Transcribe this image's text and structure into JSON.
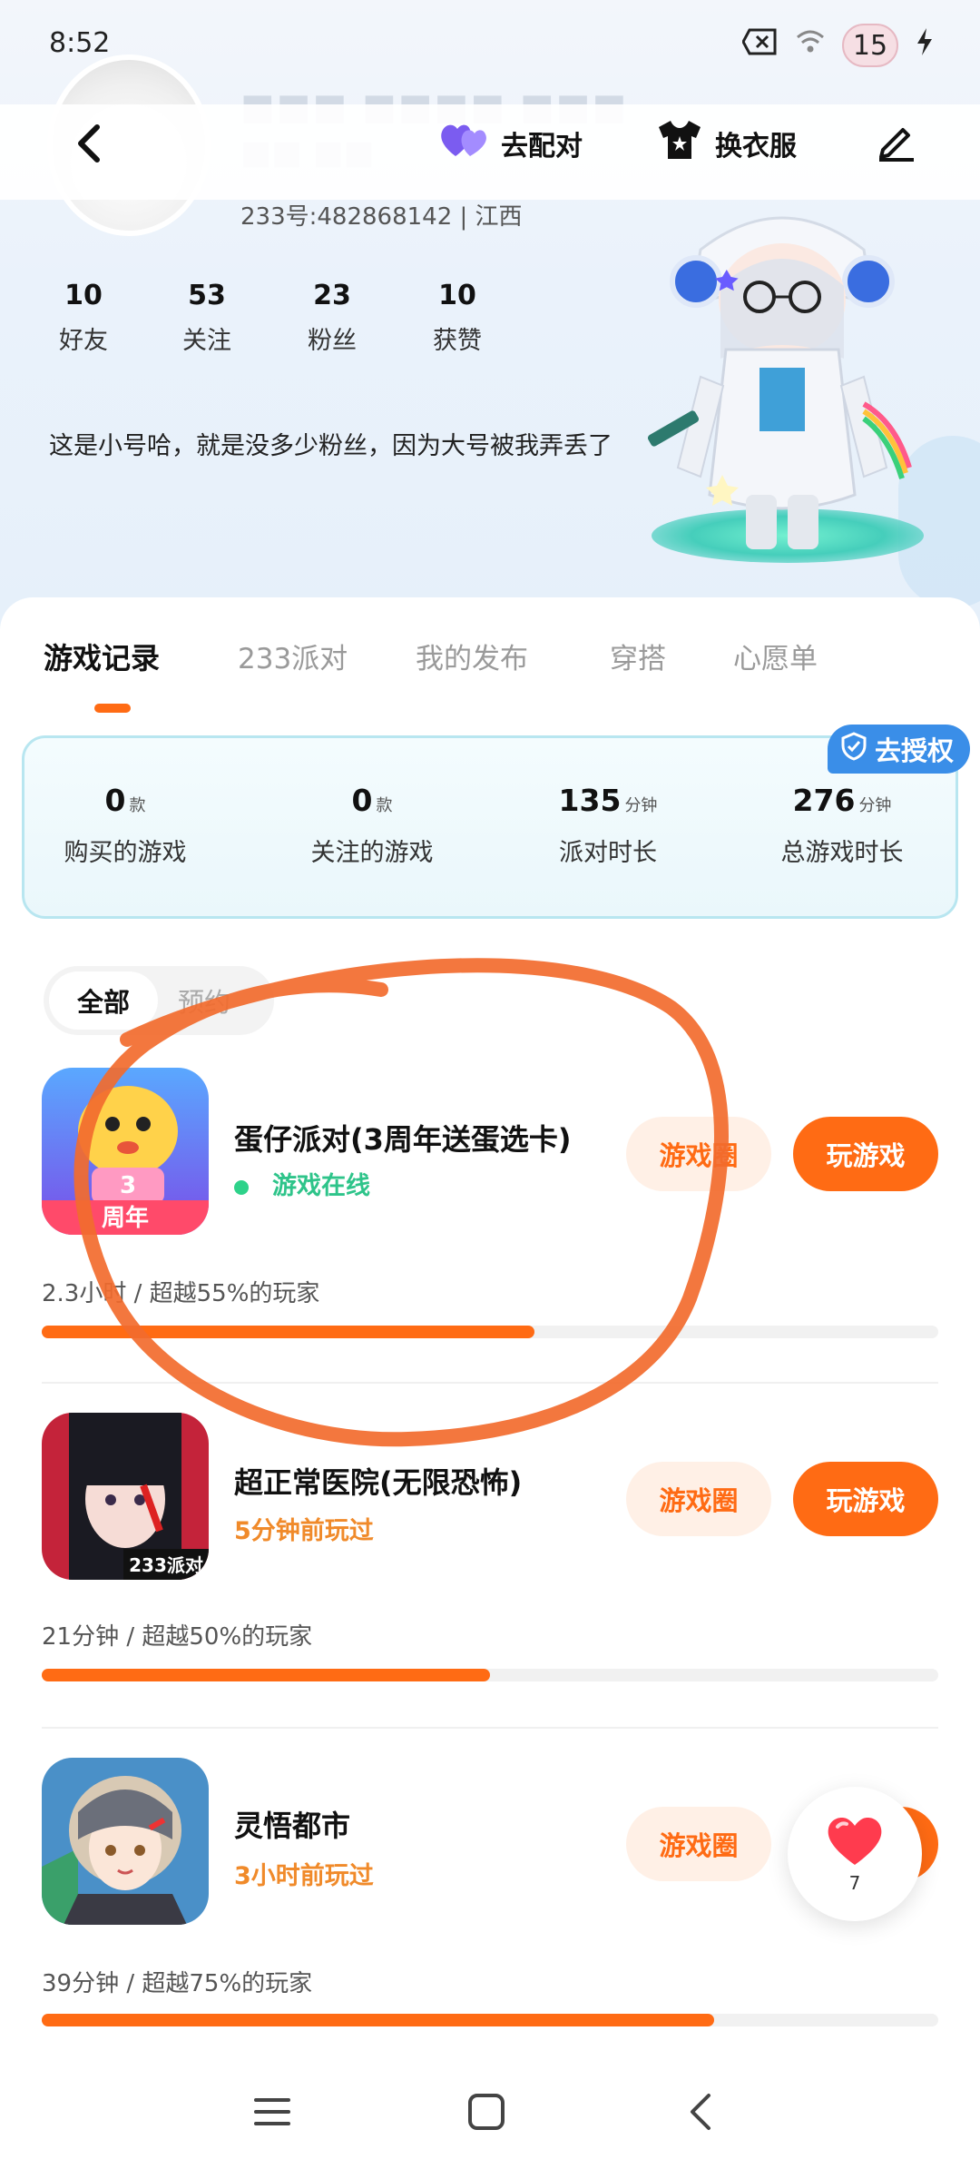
{
  "status_bar": {
    "time": "8:52",
    "icons": [
      "close-box-icon",
      "wifi-icon",
      "avatar-badge",
      "battery-charging-icon"
    ],
    "badge_text": "15"
  },
  "top_bar": {
    "pair_label": "去配对",
    "outfit_label": "换衣服"
  },
  "profile": {
    "account": "233号:482868142 | 江西",
    "stats": [
      {
        "value": "10",
        "label": "好友"
      },
      {
        "value": "53",
        "label": "关注"
      },
      {
        "value": "23",
        "label": "粉丝"
      },
      {
        "value": "10",
        "label": "获赞"
      }
    ],
    "bio": "这是小号哈，就是没多少粉丝，因为大号被我弄丢了"
  },
  "tabs": [
    {
      "label": "游戏记录",
      "active": true
    },
    {
      "label": "233派对",
      "active": false
    },
    {
      "label": "我的发布",
      "active": false
    },
    {
      "label": "穿搭",
      "active": false
    },
    {
      "label": "心愿单",
      "active": false
    }
  ],
  "summary": {
    "auth_label": "去授权",
    "items": [
      {
        "value": "0",
        "unit": "款",
        "label": "购买的游戏"
      },
      {
        "value": "0",
        "unit": "款",
        "label": "关注的游戏"
      },
      {
        "value": "135",
        "unit": "分钟",
        "label": "派对时长"
      },
      {
        "value": "276",
        "unit": "分钟",
        "label": "总游戏时长"
      }
    ]
  },
  "filters": {
    "active": "全部",
    "other": "预约"
  },
  "games": [
    {
      "title": "蛋仔派对(3周年送蛋选卡)",
      "status": "游戏在线",
      "status_color": "#2ec48a",
      "ghost_btn": "游戏圈",
      "play_btn": "玩游戏",
      "meta": "2.3小时 / 超越55%的玩家",
      "progress": 0.55
    },
    {
      "title": "超正常医院(无限恐怖)",
      "status": "5分钟前玩过",
      "status_color": "#f08a2a",
      "ghost_btn": "游戏圈",
      "play_btn": "玩游戏",
      "meta": "21分钟 / 超越50%的玩家",
      "progress": 0.5
    },
    {
      "title": "灵悟都市",
      "status": "3小时前玩过",
      "status_color": "#f08a2a",
      "ghost_btn": "游戏圈",
      "play_btn": "玩游戏",
      "meta": "39分钟 / 超越75%的玩家",
      "progress": 0.75
    }
  ],
  "like": {
    "count": "7"
  },
  "colors": {
    "accent": "#ff6b14",
    "auth_blue": "#3a8ee8",
    "online": "#2ed28a"
  }
}
